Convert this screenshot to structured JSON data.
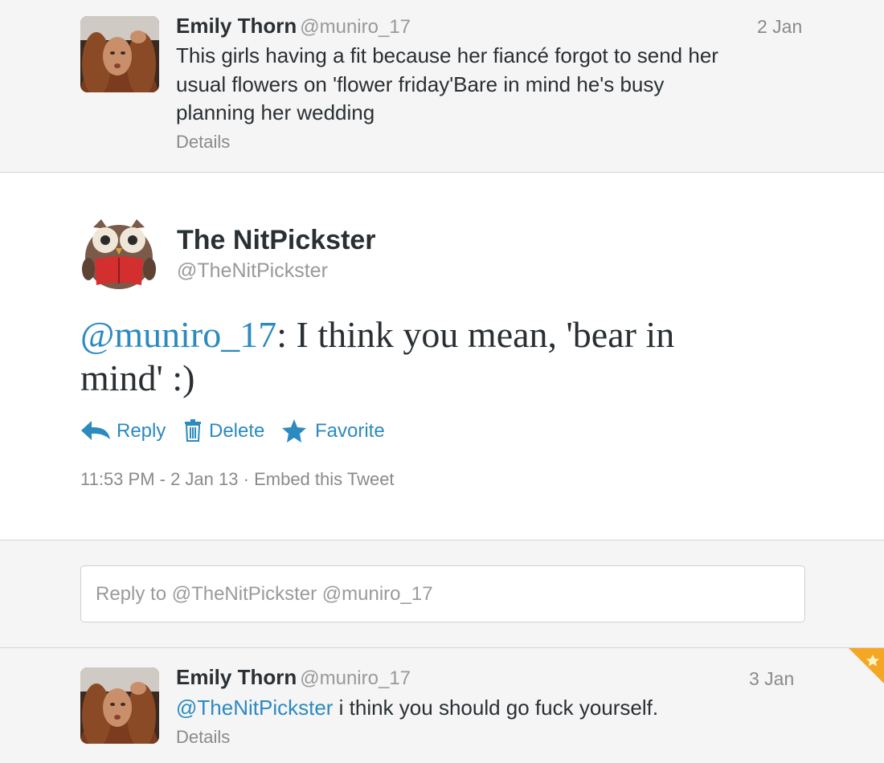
{
  "tweets": {
    "top": {
      "name": "Emily Thorn",
      "handle": "@muniro_17",
      "date": "2 Jan",
      "text_lines": [
        "This girls having a fit because her fiancé forgot to send her",
        "usual flowers on 'flower friday'Bare in mind he's busy",
        "planning her wedding"
      ],
      "details": "Details"
    },
    "main": {
      "name": "The NitPickster",
      "handle": "@TheNitPickster",
      "mention": "@muniro_17",
      "text_line1": ": I think you mean, 'bear in",
      "text_line2": "mind' :)",
      "actions": {
        "reply": "Reply",
        "delete": "Delete",
        "favorite": "Favorite"
      },
      "timestamp": "11:53 PM - 2 Jan 13",
      "separator": "·",
      "embed": "Embed this Tweet"
    },
    "bottom": {
      "name": "Emily Thorn",
      "handle": "@muniro_17",
      "date": "3 Jan",
      "mention": "@TheNitPickster",
      "text": " i think you should go fuck yourself.",
      "details": "Details"
    }
  },
  "reply": {
    "placeholder": "Reply to @TheNitPickster @muniro_17"
  },
  "colors": {
    "link": "#2b8ac0",
    "favorite_badge": "#f5a623"
  },
  "icons": {
    "reply": "reply-arrow-icon",
    "delete": "trash-icon",
    "favorite": "star-icon",
    "badge": "star-corner-badge"
  }
}
